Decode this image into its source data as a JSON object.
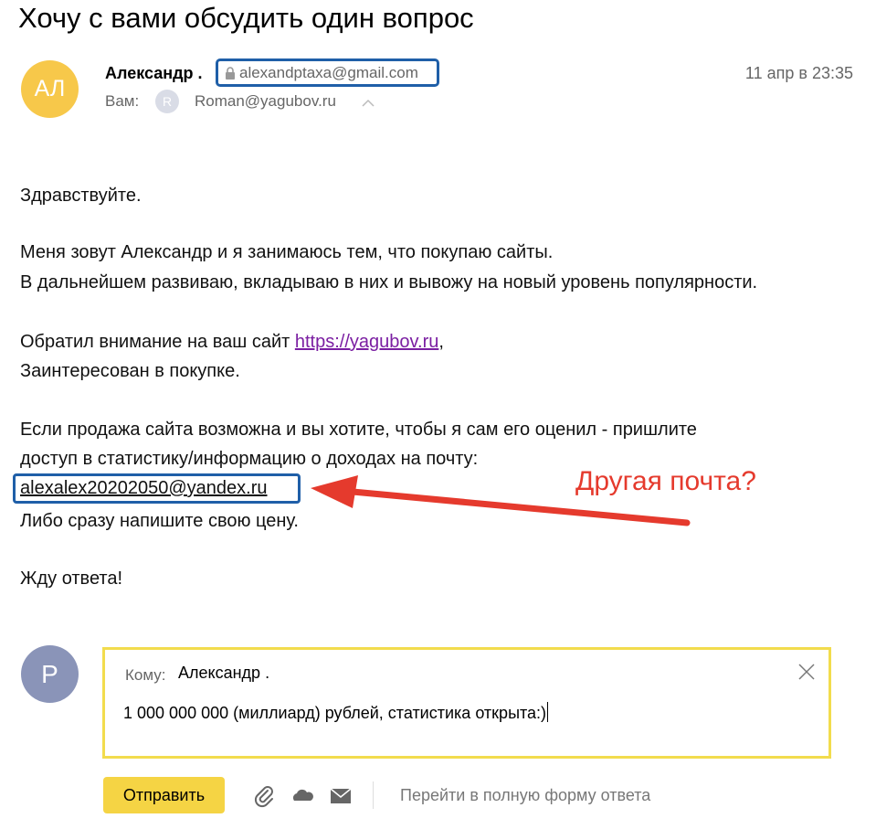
{
  "subject": "Хочу с вами обсудить один вопрос",
  "sender": {
    "avatar_initials": "АЛ",
    "name": "Александр .",
    "email": "alexandptaxa@gmail.com",
    "date": "11 апр в 23:35"
  },
  "recipient": {
    "label": "Вам:",
    "avatar_initial": "R",
    "email": "Roman@yagubov.ru"
  },
  "body": {
    "greeting": "Здравствуйте.",
    "para1_line1": "Меня зовут Александр и я занимаюсь тем, что покупаю сайты.",
    "para1_line2": "В дальнейшем развиваю, вкладываю в них и вывожу на новый уровень популярности.",
    "para2_line1_prefix": "Обратил внимание на ваш сайт ",
    "para2_link": "https://yagubov.ru",
    "para2_line1_suffix": ",",
    "para2_line2": "Заинтересован в покупке.",
    "para3_line1": "Если продажа сайта возможна и вы хотите, чтобы я сам его оценил - пришлите",
    "para3_line2": "доступ в статистику/информацию о доходах на почту:",
    "contact_email": "alexalex20202050@yandex.ru",
    "para3_line4": "Либо сразу напишите свою цену.",
    "closing": "Жду ответа!"
  },
  "annotation": {
    "text": "Другая почта?",
    "color": "#e53a2d"
  },
  "reply": {
    "avatar_initial": "Р",
    "to_label": "Кому:",
    "to_name": "Александр .",
    "text": "1 000 000 000 (миллиард) рублей, статистика открыта:)",
    "send_label": "Отправить",
    "full_form_label": "Перейти в полную форму ответа",
    "icons": [
      "paperclip-icon",
      "cloud-icon",
      "envelope-icon",
      "close-icon"
    ]
  },
  "colors": {
    "highlight_border": "#1f5fa8",
    "reply_border": "#f2dc4d",
    "send_button": "#f5d444",
    "sender_avatar": "#f7c84a",
    "reply_avatar": "#8a94b8",
    "link": "#7b1fa2"
  }
}
